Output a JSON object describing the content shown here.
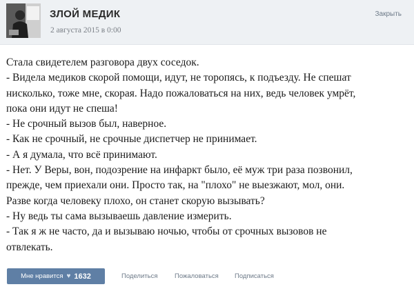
{
  "header": {
    "group_name": "ЗЛОЙ МЕДИК",
    "date": "2 августа 2015 в 0:00",
    "close_label": "Закрыть",
    "avatar_icon": "group-avatar-photo"
  },
  "post": {
    "lines": [
      "Стала свидетелем разговора двух соседок.",
      "- Видела медиков скорой помощи, идут, не торопясь, к подъезду. Не спешат",
      "нисколько, тоже мне, скорая. Надо пожаловаться на них, ведь человек умрёт,",
      "пока они идут не спеша!",
      "- Не срочный вызов был, наверное.",
      "- Как не срочный, не срочные диспетчер не принимает.",
      "- А я думала, что всё принимают.",
      "- Нет. У Веры, вон, подозрение на инфаркт было, её муж три раза позвонил,",
      "прежде, чем приехали они. Просто так, на \"плохо\" не выезжают, мол, они.",
      "Разве когда человеку плохо, он станет скорую вызывать?",
      "- Ну ведь ты сама вызываешь давление измерить.",
      "- Так я ж не часто, да и вызываю ночью, чтобы от срочных вызовов не",
      "отвлекать."
    ]
  },
  "footer": {
    "like_label": "Мне нравится",
    "like_icon": "heart-icon",
    "like_count": "1632",
    "share_label": "Поделиться",
    "report_label": "Пожаловаться",
    "subscribe_label": "Подписаться"
  },
  "colors": {
    "header_bg": "#eef1f4",
    "like_button_bg": "#5f7fa5",
    "link": "#6d7a88"
  }
}
